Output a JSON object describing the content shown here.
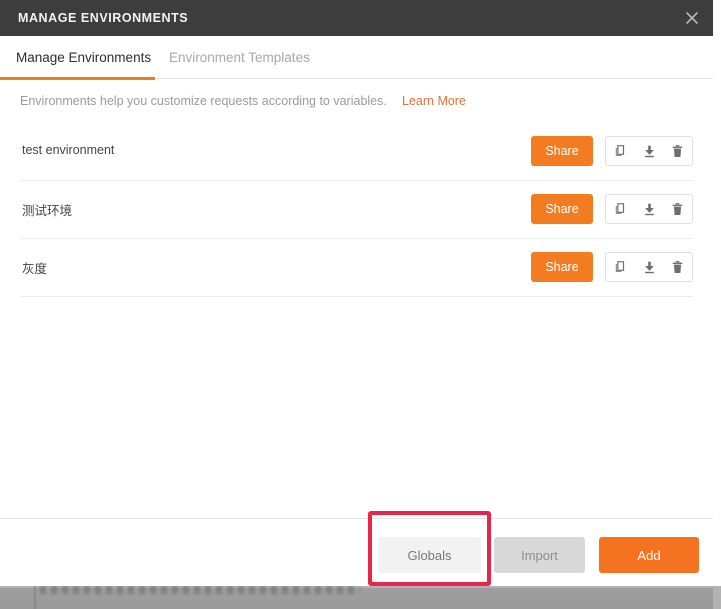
{
  "window": {
    "title": "MANAGE ENVIRONMENTS",
    "close_icon": "close-icon"
  },
  "tabs": [
    {
      "label": "Manage Environments",
      "active": true
    },
    {
      "label": "Environment Templates",
      "active": false
    }
  ],
  "description": {
    "text": "Environments help you customize requests according to variables.",
    "link_label": "Learn More"
  },
  "environments": [
    {
      "name": "test environment",
      "share_label": "Share",
      "actions": [
        "duplicate-icon",
        "download-icon",
        "delete-icon"
      ]
    },
    {
      "name": "测试环境",
      "share_label": "Share",
      "actions": [
        "duplicate-icon",
        "download-icon",
        "delete-icon"
      ]
    },
    {
      "name": "灰度",
      "share_label": "Share",
      "actions": [
        "duplicate-icon",
        "download-icon",
        "delete-icon"
      ]
    }
  ],
  "footer": {
    "globals_label": "Globals",
    "import_label": "Import",
    "add_label": "Add"
  },
  "colors": {
    "accent_orange": "#f47220",
    "titlebar_dark": "#3d3d3d",
    "tab_underline": "#ef7c1b",
    "link_orange": "#e8703a",
    "highlight_red": "#e8254b",
    "import_grey": "#d8d8d8",
    "globals_grey": "#f2f2f2"
  },
  "annotation": {
    "highlight_target": "Globals"
  }
}
